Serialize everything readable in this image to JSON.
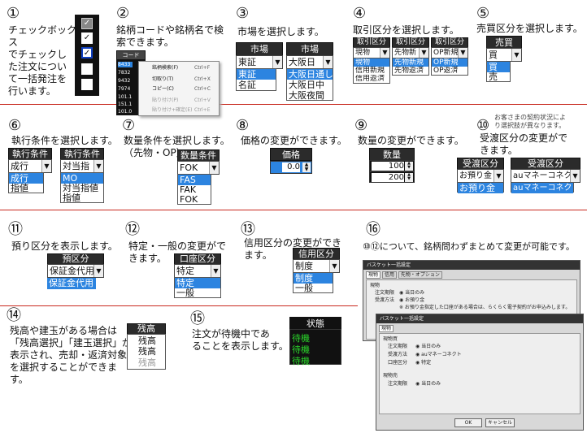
{
  "s1": {
    "num": "①",
    "desc": [
      "チェックボックス",
      "でチェックし",
      "た注文につい",
      "て一括発注を",
      "行います。"
    ]
  },
  "s2": {
    "num": "②",
    "desc": [
      "銘柄コードや銘柄名で検",
      "索できます。"
    ],
    "header": "コード",
    "codes": [
      "8433",
      "7832",
      "9432",
      "7974",
      "101.1",
      "151.1",
      "101.0"
    ],
    "menu": [
      {
        "label": "銘柄検索(F)",
        "key": "Ctrl+F"
      },
      {
        "label": "切取り(T)",
        "key": "Ctrl+X"
      },
      {
        "label": "コピー(C)",
        "key": "Ctrl+C"
      },
      {
        "label": "貼り付け(P)",
        "key": "Ctrl+V"
      },
      {
        "label": "貼り付け+確定(E)",
        "key": "Ctrl+E"
      }
    ]
  },
  "s3": {
    "num": "③",
    "desc": [
      "市場を選択します。"
    ],
    "header": "市場",
    "a_value": "東証",
    "a_options": [
      "東証",
      "名証"
    ],
    "b_value": "大阪日",
    "b_options": [
      "大阪日通し",
      "大阪日中",
      "大阪夜間"
    ]
  },
  "s4": {
    "num": "④",
    "desc": [
      "取引区分を選択します。"
    ],
    "header": "取引区分",
    "a_value": "現物",
    "a_options": [
      "現物",
      "信用新規",
      "信用返済"
    ],
    "b_value": "先物新",
    "b_options": [
      "先物新規",
      "先物返済"
    ],
    "c_value": "OP新規",
    "c_options": [
      "OP新規",
      "OP返済"
    ]
  },
  "s5": {
    "num": "⑤",
    "desc": [
      "売買区分を選択します。"
    ],
    "header": "売買",
    "value": "買",
    "options": [
      "買",
      "売"
    ]
  },
  "s6": {
    "num": "⑥",
    "desc": [
      "執行条件を選択します。"
    ],
    "header": "執行条件",
    "a_value": "成行",
    "a_options": [
      "成行",
      "指値"
    ],
    "b_value": "対当指",
    "b_options": [
      "MO",
      "対当指値",
      "指値"
    ]
  },
  "s7": {
    "num": "⑦",
    "desc": [
      "数量条件を選択します。",
      "（先物・OP）"
    ],
    "header": "数量条件",
    "value": "FOK",
    "options": [
      "FAS",
      "FAK",
      "FOK"
    ]
  },
  "s8": {
    "num": "⑧",
    "desc": [
      "価格の変更ができます。"
    ],
    "header": "価格",
    "value": "0.0"
  },
  "s9": {
    "num": "⑨",
    "desc": [
      "数量の変更ができます。"
    ],
    "header": "数量",
    "values": [
      "100",
      "200"
    ]
  },
  "s10": {
    "num": "⑩",
    "note": [
      "お客さまの契約状況によ",
      "り選択肢が異なります。"
    ],
    "desc": [
      "受渡区分の変更がで",
      "きます。"
    ],
    "header": "受渡区分",
    "a_value": "お預り金",
    "a_options": [
      "お預り金"
    ],
    "b_value": "auマネーコネクト",
    "b_options": [
      "auマネーコネクト"
    ]
  },
  "s11": {
    "num": "⑪",
    "desc": [
      "預り区分を表示します。"
    ],
    "header": "預区分",
    "rows": [
      "保証金代用",
      "保証金代用"
    ]
  },
  "s12": {
    "num": "⑫",
    "desc": [
      "特定・一般の変更がで",
      "きます。"
    ],
    "header": "口座区分",
    "value": "特定",
    "options": [
      "特定",
      "一般"
    ]
  },
  "s13": {
    "num": "⑬",
    "desc": [
      "信用区分の変更ができ",
      "ます。"
    ],
    "header": "信用区分",
    "value": "制度",
    "options": [
      "制度",
      "一般"
    ]
  },
  "s14": {
    "num": "⑭",
    "desc": [
      "残高や建玉がある場合は",
      "「残高選択」「建玉選択」が",
      "表示され、売却・返済対象",
      "を選択することができま",
      "す。"
    ],
    "header": "残高",
    "rows": [
      "残高",
      "残高",
      "残高",
      "残高"
    ]
  },
  "s15": {
    "num": "⑮",
    "desc": [
      "注文が待機中であ",
      "ることを表示します。"
    ],
    "header": "状態",
    "rows": [
      "待機",
      "待機",
      "待機"
    ]
  },
  "s16": {
    "num": "⑯",
    "desc": [
      "⑩⑫について、銘柄問わずまとめて変更が可能です。"
    ],
    "win1": {
      "title": "バスケット一括設定",
      "tabs": [
        "現物",
        "信用",
        "先物・オプション"
      ],
      "section": "現物",
      "rows": [
        {
          "k": "注文期限",
          "v": "当日のみ"
        },
        {
          "k": "受渡方法",
          "v": "お預り金"
        }
      ],
      "note": "※ お預り金指定した口座がある場合は、らくらく電子契約がお申込みします。"
    },
    "win2": {
      "title": "バスケット一括設定",
      "tab": "現物",
      "section": "現物買",
      "rows": [
        {
          "k": "注文期限",
          "v": "当日のみ"
        },
        {
          "k": "受渡方法",
          "v": "auマネーコネクト"
        },
        {
          "k": "口座区分",
          "v": "特定"
        }
      ],
      "section2": "現物売",
      "rows2": [
        {
          "k": "注文期限",
          "v": "当日のみ"
        }
      ],
      "ok": "OK",
      "cancel": "キャンセル"
    }
  }
}
